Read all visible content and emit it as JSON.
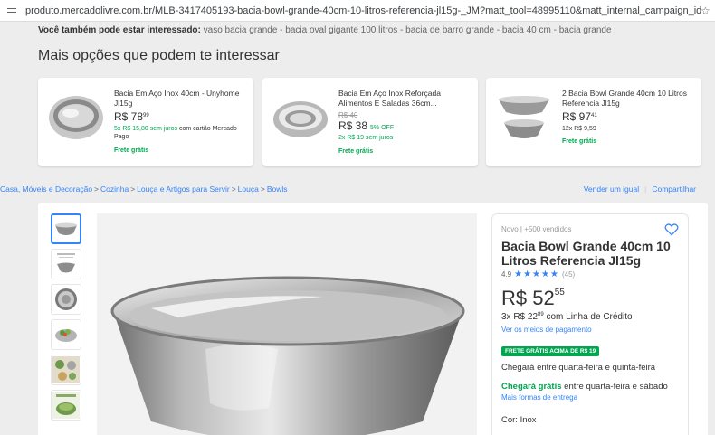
{
  "browser": {
    "url": "produto.mercadolivre.com.br/MLB-3417405193-bacia-bowl-grande-40cm-10-litros-referencia-jl15g-_JM?matt_tool=48995110&matt_internal_campaign_id=&matt_word=&matt_source=googl..."
  },
  "related": {
    "label": "Você também pode estar interessado:",
    "items": [
      "vaso bacia grande",
      "bacia oval gigante 100 litros",
      "bacia de barro grande",
      "bacia 40 cm",
      "bacia grande"
    ],
    "separator": " - "
  },
  "section_title": "Mais opções que podem te interessar",
  "cards": [
    {
      "title": "Bacia Em Aço Inox 40cm - Unyhome Jl15g",
      "price_int": "R$ 78",
      "price_cents": "99",
      "installments": "5x R$ 15,80 sem juros",
      "installments_suffix": "com cartão Mercado Pago",
      "shipping": "Frete grátis"
    },
    {
      "title": "Bacia Em Aço Inox Reforçada Alimentos E Saladas 36cm...",
      "old_price": "R$ 40",
      "price_int": "R$ 38",
      "discount": "5% OFF",
      "installments": "2x R$ 19 sem juros",
      "shipping": "Frete grátis"
    },
    {
      "title": "2 Bacia Bowl Grande 40cm 10 Litros Referencia Jl15g",
      "price_int": "R$ 97",
      "price_cents": "41",
      "installments": "12x R$ 9,59",
      "shipping": "Frete grátis"
    }
  ],
  "breadcrumb": [
    "Casa, Móveis e Decoração",
    "Cozinha",
    "Louça e Artigos para Servir",
    "Louça",
    "Bowls"
  ],
  "breadcrumb_sep": ">",
  "actions": {
    "sell": "Vender um igual",
    "share": "Compartilhar",
    "divider": "|"
  },
  "product": {
    "condition": "Novo  |  +500 vendidos",
    "title": "Bacia Bowl Grande 40cm 10 Litros Referencia Jl15g",
    "rating": "4.9",
    "stars": "★★★★★",
    "reviews": "(45)",
    "price_int": "R$ 52",
    "price_cents": "55",
    "installments_pre": "3x R$ 22",
    "installments_cents": "89",
    "installments_post": " com Linha de Crédito",
    "payment_link": "Ver os meios de pagamento",
    "badge": "FRETE GRÁTIS ACIMA DE R$ 19",
    "arrival": "Chegará entre quarta-feira e quinta-feira",
    "arrival_free": "Chegará grátis",
    "arrival_free_rest": " entre quarta-feira e sábado",
    "shipping_link": "Mais formas de entrega",
    "color_label": "Cor: ",
    "color_value": "Inox"
  },
  "colors": {
    "accent": "#3483fa",
    "green": "#00a650",
    "background": "#ededed"
  },
  "icons": [
    "tune-icon",
    "star-bookmark-icon",
    "heart-icon"
  ]
}
